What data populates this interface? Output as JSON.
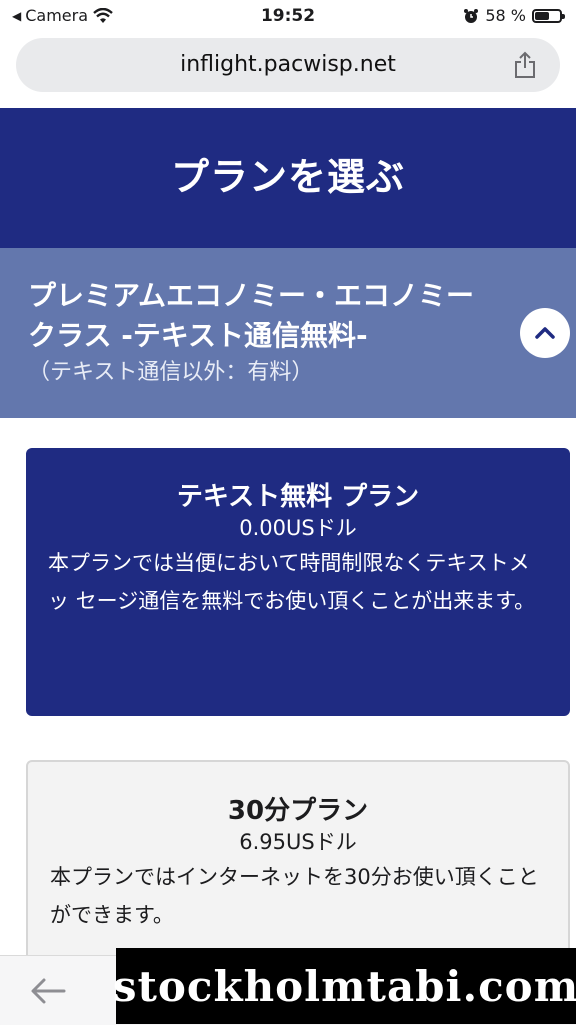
{
  "status_bar": {
    "back_app": "Camera",
    "time": "19:52",
    "battery_percent": "58 %",
    "battery_level": 0.58
  },
  "browser": {
    "url": "inflight.pacwisp.net"
  },
  "header": {
    "title": "プランを選ぶ"
  },
  "accordion": {
    "title": "プレミアムエコノミー・エコノミークラス -テキスト通信無料-",
    "subtitle": "（テキスト通信以外：有料）"
  },
  "plans": [
    {
      "name": "テキスト無料 プラン",
      "price": "0.00USドル",
      "description": "本プランでは当便において時間制限なくテキストメッ セージ通信を無料でお使い頂くことが出来ます。"
    },
    {
      "name": "30分プラン",
      "price": "6.95USドル",
      "description": "本プランではインターネットを30分お使い頂くことができます。"
    }
  ],
  "watermark": "stockholmtabi.com",
  "colors": {
    "header_bg": "#1f2b82",
    "accordion_bg": "#6377ad",
    "selected_card_bg": "#1f2b82"
  }
}
